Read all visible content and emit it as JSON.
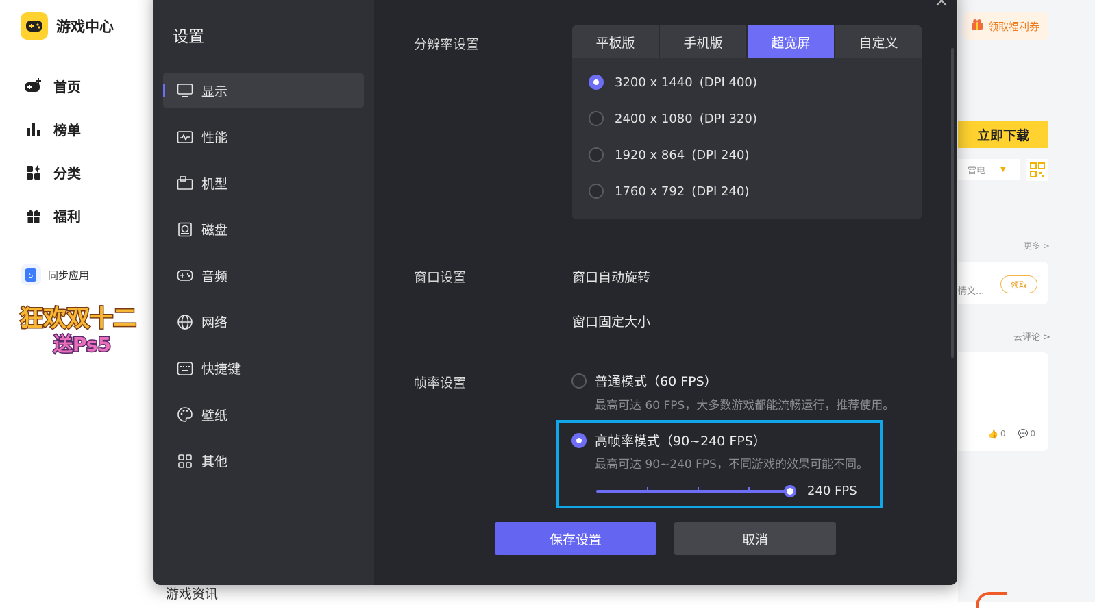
{
  "app": {
    "title": "游戏中心",
    "nav": [
      {
        "label": "首页",
        "icon": "gamepad-plus-icon"
      },
      {
        "label": "榜单",
        "icon": "chart-bars-icon"
      },
      {
        "label": "分类",
        "icon": "category-icon"
      },
      {
        "label": "福利",
        "icon": "gift-icon"
      }
    ],
    "sync_label": "同步应用",
    "promo_line1": "狂欢双十二",
    "promo_line2": "送Ps5",
    "news_title": "游戏资讯"
  },
  "right_panel": {
    "coupon_label": "领取福利券",
    "download_label": "立即下载",
    "leidian_label": "雷电",
    "more_link": "更多 >",
    "claim_text": "情义...",
    "claim_button": "领取",
    "comment_link": "去评论 >",
    "likes": "0",
    "comments": "0"
  },
  "settings": {
    "title": "设置",
    "nav": [
      {
        "label": "显示",
        "icon": "monitor-icon",
        "active": true
      },
      {
        "label": "性能",
        "icon": "performance-icon"
      },
      {
        "label": "机型",
        "icon": "device-model-icon"
      },
      {
        "label": "磁盘",
        "icon": "disk-icon"
      },
      {
        "label": "音频",
        "icon": "gamepad-icon"
      },
      {
        "label": "网络",
        "icon": "globe-icon"
      },
      {
        "label": "快捷键",
        "icon": "keyboard-icon"
      },
      {
        "label": "壁纸",
        "icon": "palette-icon"
      },
      {
        "label": "其他",
        "icon": "grid-icon"
      }
    ],
    "resolution": {
      "label": "分辨率设置",
      "tabs": [
        "平板版",
        "手机版",
        "超宽屏",
        "自定义"
      ],
      "active_tab": "超宽屏",
      "options": [
        {
          "resolution": "3200 x 1440",
          "dpi": "(DPI 400)",
          "selected": true
        },
        {
          "resolution": "2400 x 1080",
          "dpi": "(DPI 320)",
          "selected": false
        },
        {
          "resolution": "1920 x 864",
          "dpi": "(DPI 240)",
          "selected": false
        },
        {
          "resolution": "1760 x 792",
          "dpi": "(DPI 240)",
          "selected": false
        }
      ]
    },
    "window": {
      "label": "窗口设置",
      "auto_rotate": {
        "label": "窗口自动旋转",
        "on": true
      },
      "fixed_size": {
        "label": "窗口固定大小",
        "on": false
      }
    },
    "framerate": {
      "label": "帧率设置",
      "normal": {
        "title": "普通模式（60 FPS）",
        "desc": "最高可达 60 FPS，大多数游戏都能流畅运行，推荐使用。",
        "selected": false
      },
      "high": {
        "title": "高帧率模式（90~240 FPS）",
        "desc": "最高可达 90~240 FPS，不同游戏的效果可能不同。",
        "selected": true
      },
      "slider_value": "240 FPS",
      "slider_fraction": 1.0
    },
    "buttons": {
      "save": "保存设置",
      "cancel": "取消"
    }
  },
  "colors": {
    "accent": "#6d6ef5",
    "highlight_border": "#11a6e8",
    "brand_yellow": "#ffd22f"
  }
}
